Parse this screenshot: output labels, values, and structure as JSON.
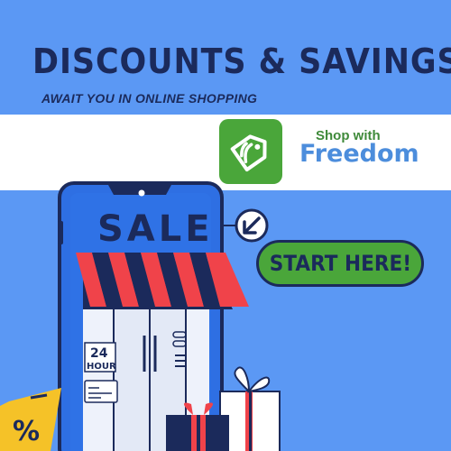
{
  "headline": "DISCOUNTS & SAVINGS",
  "subheadline": "AWAIT YOU IN ONLINE SHOPPING",
  "brand": {
    "line1": "Shop with",
    "line2": "Freedom",
    "logo_icon": "price-tag-icon"
  },
  "phone": {
    "sign": "SALE",
    "hour_number": "24",
    "hour_label": "HOUR"
  },
  "cta": {
    "label": "START HERE!",
    "icon": "arrow-down-left-icon"
  },
  "badge": {
    "symbol": "%"
  },
  "colors": {
    "background": "#5b98f4",
    "navy": "#1b2a5b",
    "green": "#4aa63a",
    "awning_red": "#f0434a",
    "phone_blue": "#2e6fe3",
    "badge_yellow": "#f5c228"
  }
}
